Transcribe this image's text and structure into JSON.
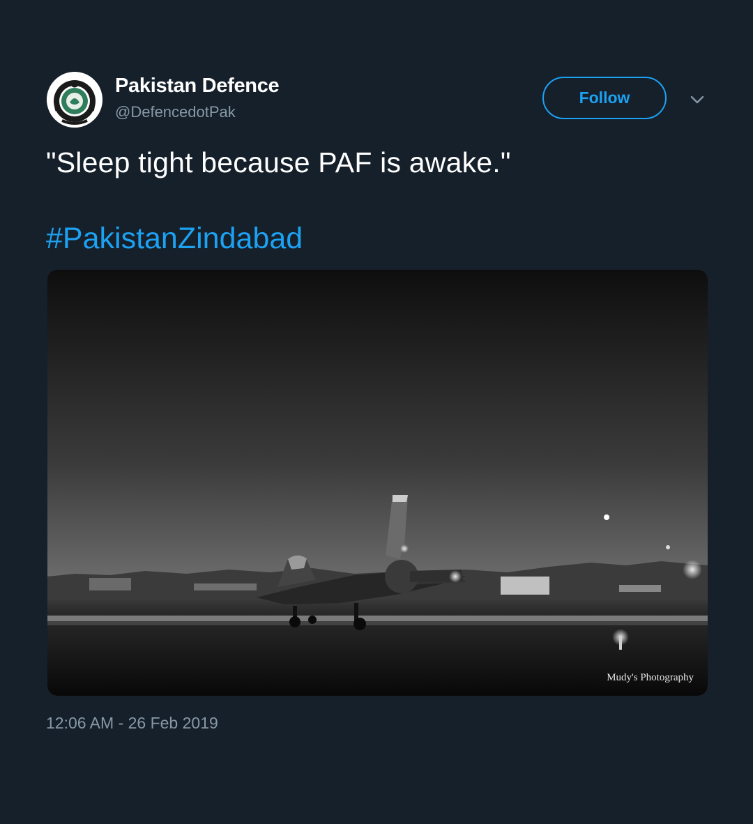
{
  "author": {
    "display_name": "Pakistan Defence",
    "handle": "@DefencedotPak",
    "avatar_icon": "pakistan-defence-emblem"
  },
  "actions": {
    "follow_label": "Follow",
    "more_icon": "chevron-down-icon"
  },
  "tweet": {
    "text": "\"Sleep tight because PAF is awake.\"",
    "hashtag": "#PakistanZindabad",
    "timestamp": "12:06 AM - 26 Feb 2019"
  },
  "media": {
    "description_icon": "fighter-jet-night-photo",
    "watermark": "Mudy's Photography"
  },
  "colors": {
    "background": "#15202b",
    "accent": "#1da1f2",
    "secondary_text": "#8899a6"
  }
}
